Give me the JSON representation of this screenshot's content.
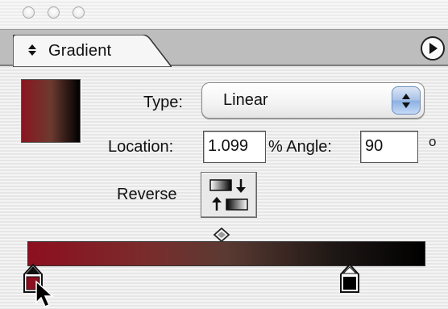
{
  "panel": {
    "tab_label": "Gradient",
    "tab_arrows_glyph": "⬍"
  },
  "gradient": {
    "type_label": "Type:",
    "type_value": "Linear",
    "location_label": "Location:",
    "location_value": "1.099",
    "location_unit": "% Angle:",
    "angle_value": "90",
    "angle_unit": "o",
    "reverse_label": "Reverse",
    "colors": {
      "start": "#8d0f1f",
      "end": "#000000"
    }
  }
}
